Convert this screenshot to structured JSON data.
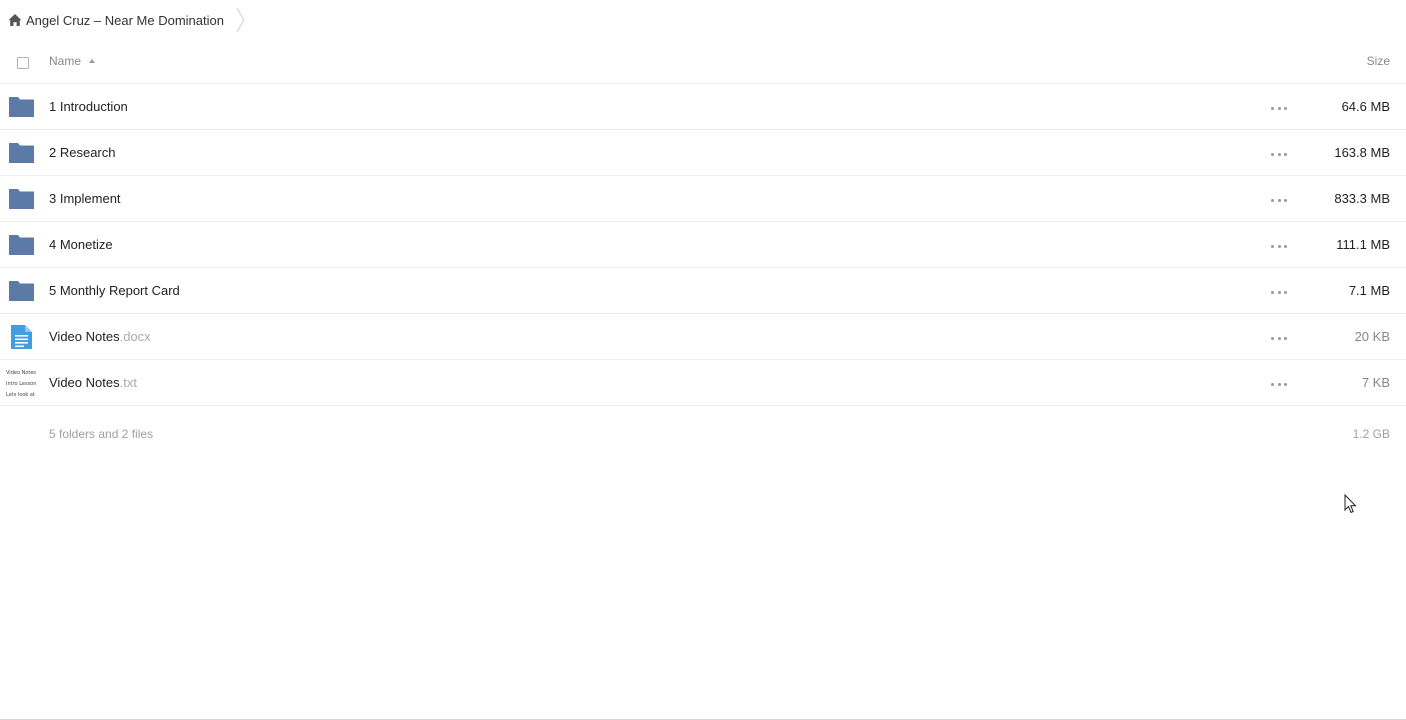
{
  "breadcrumb": {
    "home_icon": "home-icon",
    "label": "Angel Cruz – Near Me Domination"
  },
  "header": {
    "name_label": "Name",
    "size_label": "Size",
    "sort": "ascending"
  },
  "files": [
    {
      "type": "folder",
      "name": "1 Introduction",
      "ext": "",
      "size": "64.6 MB"
    },
    {
      "type": "folder",
      "name": "2 Research",
      "ext": "",
      "size": "163.8 MB"
    },
    {
      "type": "folder",
      "name": "3 Implement",
      "ext": "",
      "size": "833.3 MB"
    },
    {
      "type": "folder",
      "name": "4 Monetize",
      "ext": "",
      "size": "111.1 MB"
    },
    {
      "type": "folder",
      "name": "5 Monthly Report Card",
      "ext": "",
      "size": "7.1 MB"
    },
    {
      "type": "document",
      "name": "Video Notes",
      "ext": ".docx",
      "size": "20 KB"
    },
    {
      "type": "text",
      "name": "Video Notes",
      "ext": ".txt",
      "size": "7 KB",
      "preview_lines": [
        "Video Notes",
        "Intro Lesson",
        "Lets look at"
      ]
    }
  ],
  "summary": {
    "count_label": "5 folders and 2 files",
    "total_size": "1.2 GB"
  },
  "colors": {
    "folder": "#5b7aa6",
    "document": "#3f9fe0"
  }
}
